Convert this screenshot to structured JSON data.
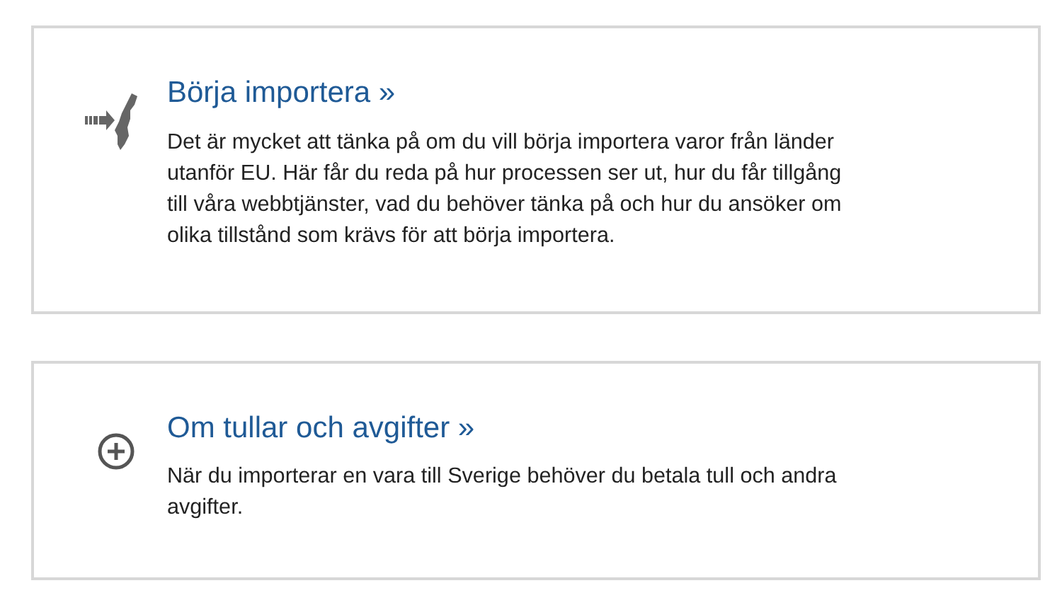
{
  "cards": [
    {
      "kind": "import",
      "title": "Börja importera »",
      "text": "Det är mycket att tänka på om du vill börja importera varor från länder utanför EU. Här får du reda på hur processen ser ut, hur du får tillgång till våra webbtjänster, vad du behöver tänka på och hur du ansöker om olika tillstånd som krävs för att börja importera."
    },
    {
      "kind": "plus",
      "title": "Om tullar och avgifter »",
      "text": "När du importerar en vara till Sverige behöver du betala tull och andra avgifter."
    }
  ]
}
